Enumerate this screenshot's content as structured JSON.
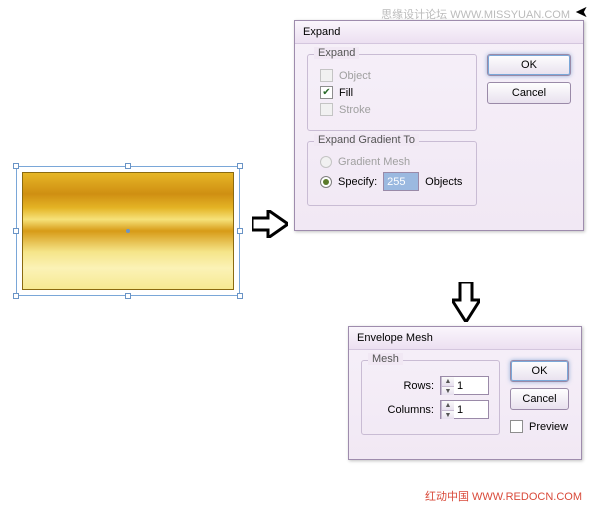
{
  "watermarks": {
    "top": "思缘设计论坛  WWW.MISSYUAN.COM",
    "bottom": "红动中国  WWW.REDOCN.COM"
  },
  "dlg_expand": {
    "title": "Expand",
    "group_expand": {
      "legend": "Expand",
      "object": {
        "label": "Object",
        "checked": false,
        "enabled": false
      },
      "fill": {
        "label": "Fill",
        "checked": true,
        "enabled": true
      },
      "stroke": {
        "label": "Stroke",
        "checked": false,
        "enabled": false
      }
    },
    "group_gradient": {
      "legend": "Expand Gradient To",
      "mesh": {
        "label": "Gradient Mesh",
        "selected": false,
        "enabled": false
      },
      "specify": {
        "label": "Specify:",
        "selected": true,
        "value": "255",
        "suffix": "Objects"
      }
    },
    "ok": "OK",
    "cancel": "Cancel"
  },
  "dlg_mesh": {
    "title": "Envelope Mesh",
    "group": {
      "legend": "Mesh",
      "rows": {
        "label": "Rows:",
        "value": "1"
      },
      "columns": {
        "label": "Columns:",
        "value": "1"
      }
    },
    "ok": "OK",
    "cancel": "Cancel",
    "preview": {
      "label": "Preview",
      "checked": false
    }
  }
}
